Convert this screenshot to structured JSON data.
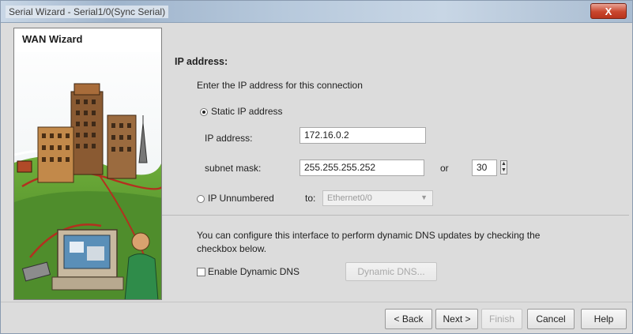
{
  "window": {
    "title": "Serial Wizard - Serial1/0(Sync Serial)",
    "close_label": "X"
  },
  "side_panel": {
    "title": "WAN Wizard"
  },
  "ip_section": {
    "heading": "IP address:",
    "instruction": "Enter the IP address for this connection",
    "static_label": "Static IP address",
    "static_selected": true,
    "ip_label": "IP address:",
    "ip_value": "172.16.0.2",
    "mask_label": "subnet mask:",
    "mask_value": "255.255.255.252",
    "or_label": "or",
    "prefix_value": "30",
    "unnumbered_label": "IP Unnumbered",
    "unnumbered_selected": false,
    "to_label": "to:",
    "interface_value": "Ethernet0/0"
  },
  "dns_section": {
    "description_line1": "You can configure this interface to perform dynamic DNS updates by checking the",
    "description_line2": "checkbox below.",
    "checkbox_label": "Enable Dynamic DNS",
    "checked": false,
    "button_label": "Dynamic DNS..."
  },
  "footer": {
    "back_label": "< Back",
    "next_label": "Next >",
    "finish_label": "Finish",
    "cancel_label": "Cancel",
    "help_label": "Help"
  },
  "colors": {
    "window_bg": "#dcdcdc",
    "titlebar_accent": "#9fb4cc",
    "close_button": "#c9462d",
    "disabled_text": "#a8a8a8"
  }
}
